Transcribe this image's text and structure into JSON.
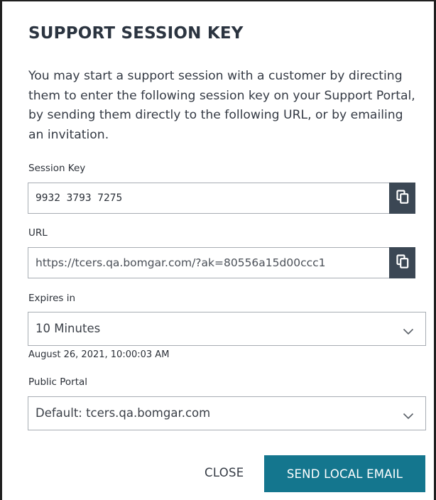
{
  "dialog": {
    "title": "SUPPORT SESSION KEY",
    "description": "You may start a support session with a customer by directing them to enter the following session key on your Support Portal, by sending them directly to the following URL, or by emailing an invitation."
  },
  "session_key": {
    "label": "Session Key",
    "value": "9932 3793 7275",
    "copy_icon": "copy-icon"
  },
  "url": {
    "label": "URL",
    "value": "https://tcers.qa.bomgar.com/?ak=80556a15d00ccc1",
    "copy_icon": "copy-icon"
  },
  "expires": {
    "label": "Expires in",
    "selected": "10 Minutes",
    "date_text": "August 26, 2021, 10:00:03 AM",
    "chevron_icon": "chevron-down-icon"
  },
  "portal": {
    "label": "Public Portal",
    "selected": "Default: tcers.qa.bomgar.com",
    "chevron_icon": "chevron-down-icon"
  },
  "actions": {
    "close_label": "CLOSE",
    "send_label": "SEND LOCAL EMAIL"
  },
  "colors": {
    "primary_button": "#14768e",
    "copy_button": "#3b4754",
    "border": "#a7acb3",
    "text": "#2b3038"
  }
}
